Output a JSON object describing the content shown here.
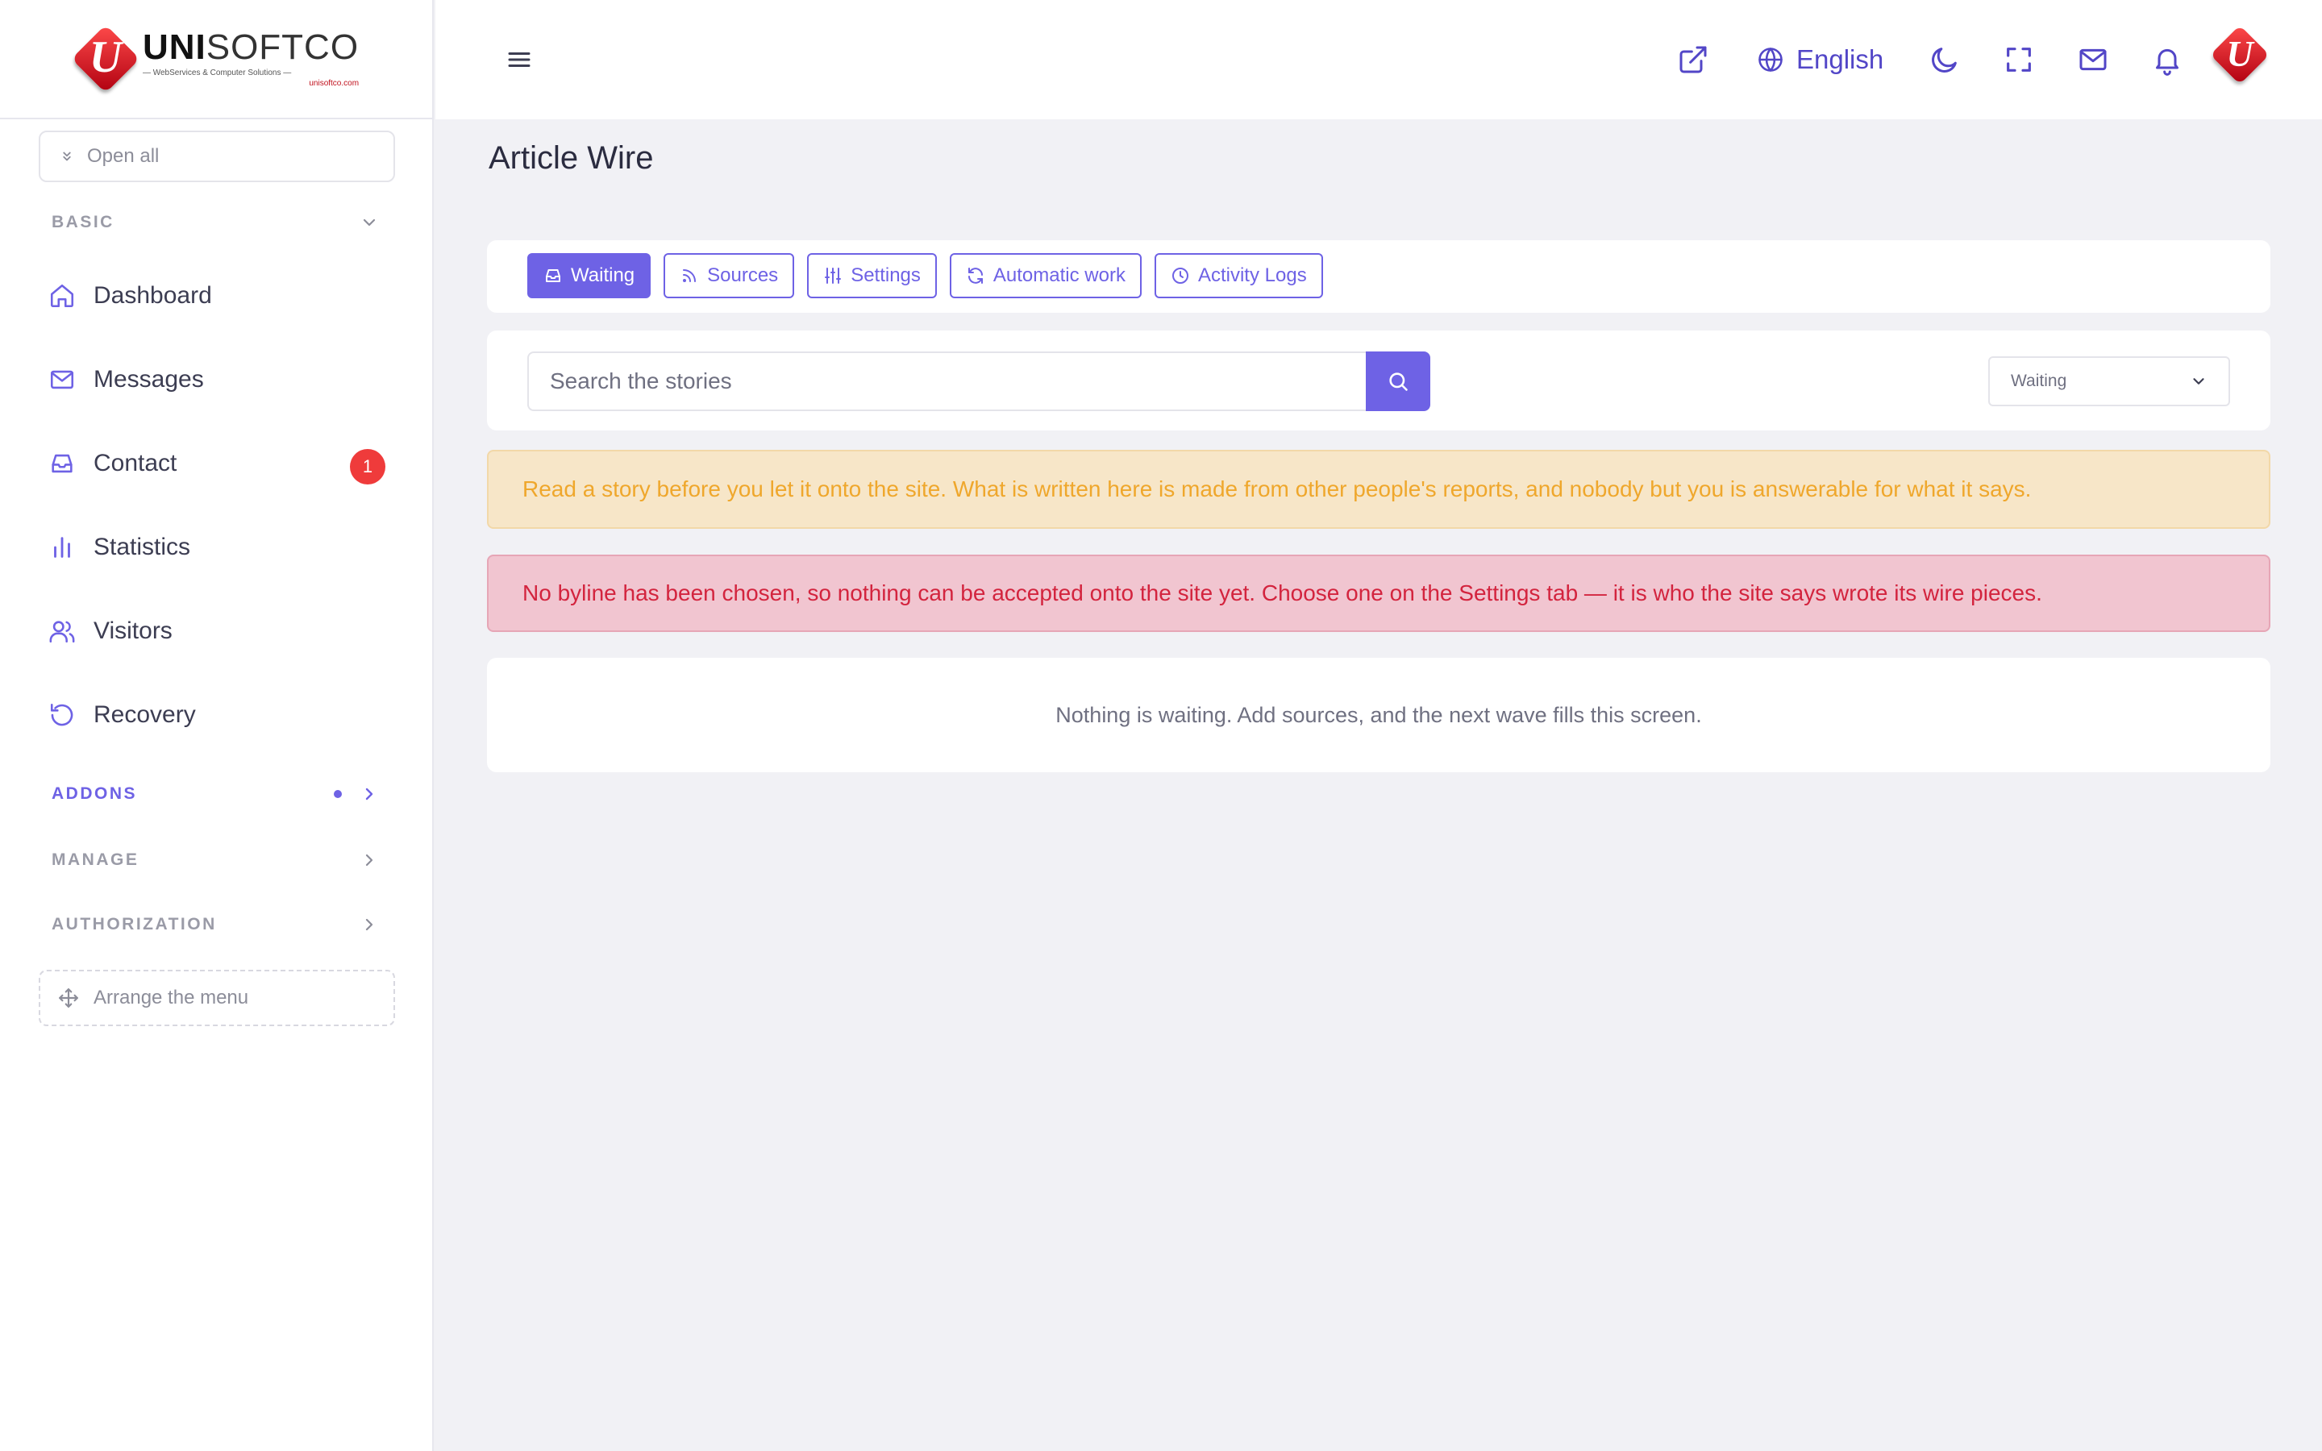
{
  "brand": {
    "name_bold": "UNI",
    "name_light": "SOFTCO",
    "tagline": "— WebServices & Computer Solutions —",
    "url": "unisoftco.com",
    "mark_letter": "U"
  },
  "sidebar": {
    "open_all_label": "Open all",
    "sections": {
      "basic": "BASIC",
      "addons": "ADDONS",
      "manage": "MANAGE",
      "authorization": "AUTHORIZATION"
    },
    "items": [
      {
        "label": "Dashboard",
        "icon": "home-icon"
      },
      {
        "label": "Messages",
        "icon": "mail-icon"
      },
      {
        "label": "Contact",
        "icon": "inbox-icon",
        "badge": "1"
      },
      {
        "label": "Statistics",
        "icon": "bar-chart-icon"
      },
      {
        "label": "Visitors",
        "icon": "users-icon"
      },
      {
        "label": "Recovery",
        "icon": "history-icon"
      }
    ],
    "arrange_label": "Arrange the menu"
  },
  "topbar": {
    "language": "English",
    "icons": [
      "menu-icon",
      "external-link-icon",
      "globe-icon",
      "moon-icon",
      "fullscreen-icon",
      "mail-icon",
      "bell-icon"
    ]
  },
  "page": {
    "title": "Article Wire"
  },
  "tabs": [
    {
      "label": "Waiting",
      "icon": "inbox-icon",
      "active": true
    },
    {
      "label": "Sources",
      "icon": "rss-icon",
      "active": false
    },
    {
      "label": "Settings",
      "icon": "sliders-icon",
      "active": false
    },
    {
      "label": "Automatic work",
      "icon": "refresh-icon",
      "active": false
    },
    {
      "label": "Activity Logs",
      "icon": "clock-icon",
      "active": false
    }
  ],
  "search": {
    "placeholder": "Search the stories",
    "value": ""
  },
  "filter": {
    "selected": "Waiting"
  },
  "alerts": {
    "warning": "Read a story before you let it onto the site. What is written here is made from other people's reports, and nobody but you is answerable for what it says.",
    "danger": "No byline has been chosen, so nothing can be accepted onto the site yet. Choose one on the Settings tab — it is who the site says wrote its wire pieces."
  },
  "empty_state": "Nothing is waiting. Add sources, and the next wave fills this screen.",
  "colors": {
    "accent": "#6e62e5",
    "badge": "#ef3b3b",
    "warning_text": "#efa72c",
    "danger_text": "#d3243e"
  }
}
